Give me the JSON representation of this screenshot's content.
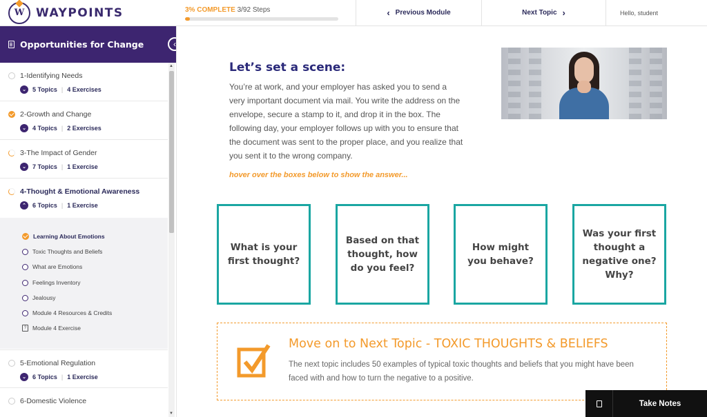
{
  "header": {
    "logo_text": "WAYPOINTS",
    "logo_letter": "W",
    "progress_label": "3% COMPLETE",
    "progress_steps": "3/92 Steps",
    "progress_fraction": 0.03,
    "prev_label": "Previous Module",
    "next_label": "Next Topic",
    "greeting": "Hello, student"
  },
  "sidebar": {
    "title": "Opportunities for Change",
    "modules": [
      {
        "title": "1-Identifying Needs",
        "topics": "5 Topics",
        "exercises": "4 Exercises",
        "status": "empty"
      },
      {
        "title": "2-Growth and Change",
        "topics": "4 Topics",
        "exercises": "2 Exercises",
        "status": "done"
      },
      {
        "title": "3-The Impact of Gender",
        "topics": "7 Topics",
        "exercises": "1 Exercise",
        "status": "partial"
      },
      {
        "title": "4-Thought & Emotional Awareness",
        "topics": "6 Topics",
        "exercises": "1 Exercise",
        "status": "partial"
      },
      {
        "title": "5-Emotional Regulation",
        "topics": "6 Topics",
        "exercises": "1 Exercise",
        "status": "empty"
      },
      {
        "title": "6-Domestic Violence",
        "status": "empty"
      }
    ],
    "active_topics": [
      {
        "label": "Learning About Emotions",
        "status": "done"
      },
      {
        "label": "Toxic Thoughts and Beliefs",
        "status": "open"
      },
      {
        "label": "What are Emotions",
        "status": "open"
      },
      {
        "label": "Feelings Inventory",
        "status": "open"
      },
      {
        "label": "Jealousy",
        "status": "open"
      },
      {
        "label": "Module 4 Resources & Credits",
        "status": "open"
      },
      {
        "label": "Module 4 Exercise",
        "status": "quiz"
      }
    ]
  },
  "main": {
    "scene_title": "Let’s set a scene:",
    "scene_text": "You’re at work, and your employer has asked you to send a very important document via mail.  You write the address on the envelope, secure a stamp to it, and drop it in the box.  The following day, your employer follows up with you to ensure that the document was sent to the proper place, and you realize that you sent it to the wrong company.",
    "hover_hint": "hover over the boxes below to show the answer...",
    "boxes": [
      "What is your first thought?",
      "Based on that thought, how do you feel?",
      "How might you behave?",
      "Was your first thought a negative one? Why?"
    ],
    "next_topic_title": "Move on to Next Topic - TOXIC THOUGHTS & BELIEFS",
    "next_topic_text": "The next topic includes 50 examples of typical toxic thoughts and beliefs that you might have been faced with and how to turn the negative to a positive."
  },
  "notes_button": "Take Notes",
  "colors": {
    "purple": "#3d2570",
    "orange": "#f39a2b",
    "teal": "#1aa6a2",
    "navy": "#2b2a7a"
  }
}
